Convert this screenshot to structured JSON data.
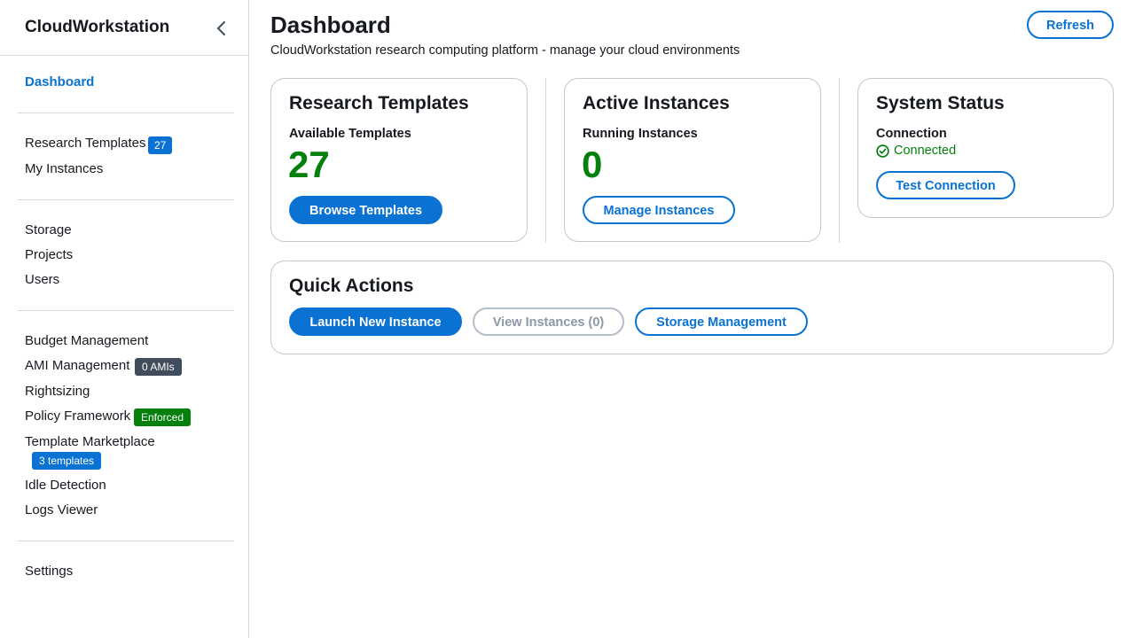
{
  "sidebar": {
    "title": "CloudWorkstation",
    "items": {
      "dashboard": "Dashboard",
      "research_templates": "Research Templates",
      "research_templates_badge": "27",
      "my_instances": "My Instances",
      "storage": "Storage",
      "projects": "Projects",
      "users": "Users",
      "budget_management": "Budget Management",
      "ami_management": "AMI Management",
      "ami_badge": "0 AMIs",
      "rightsizing": "Rightsizing",
      "policy_framework": "Policy Framework",
      "policy_badge": "Enforced",
      "template_marketplace": "Template Marketplace",
      "marketplace_badge": "3 templates",
      "idle_detection": "Idle Detection",
      "logs_viewer": "Logs Viewer",
      "settings": "Settings"
    }
  },
  "header": {
    "title": "Dashboard",
    "description": "CloudWorkstation research computing platform - manage your cloud environments",
    "refresh_label": "Refresh"
  },
  "cards": {
    "templates": {
      "title": "Research Templates",
      "label": "Available Templates",
      "value": "27",
      "button": "Browse Templates"
    },
    "instances": {
      "title": "Active Instances",
      "label": "Running Instances",
      "value": "0",
      "button": "Manage Instances"
    },
    "status": {
      "title": "System Status",
      "label": "Connection",
      "status": "Connected",
      "button": "Test Connection"
    }
  },
  "quick_actions": {
    "title": "Quick Actions",
    "launch": "Launch New Instance",
    "view": "View Instances (0)",
    "storage": "Storage Management"
  },
  "colors": {
    "accent": "#0972d3",
    "success": "#037f0c",
    "badge_grey": "#414d5c"
  }
}
